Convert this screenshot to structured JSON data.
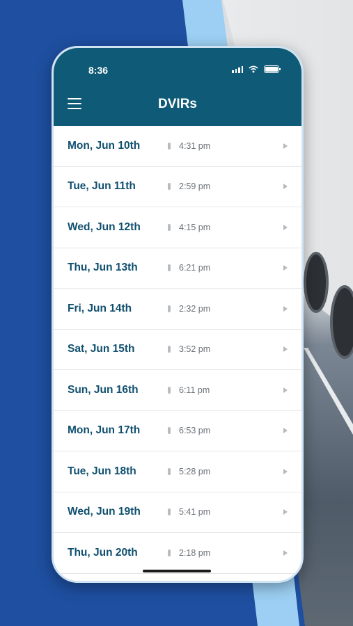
{
  "status": {
    "time": "8:36"
  },
  "header": {
    "title": "DVIRs"
  },
  "rows": [
    {
      "date": "Mon, Jun 10th",
      "time": "4:31 pm"
    },
    {
      "date": "Tue, Jun 11th",
      "time": "2:59 pm"
    },
    {
      "date": "Wed, Jun 12th",
      "time": "4:15 pm"
    },
    {
      "date": "Thu, Jun 13th",
      "time": "6:21 pm"
    },
    {
      "date": "Fri, Jun 14th",
      "time": "2:32 pm"
    },
    {
      "date": "Sat, Jun 15th",
      "time": "3:52 pm"
    },
    {
      "date": "Sun, Jun 16th",
      "time": "6:11 pm"
    },
    {
      "date": "Mon, Jun 17th",
      "time": "6:53 pm"
    },
    {
      "date": "Tue, Jun 18th",
      "time": "5:28 pm"
    },
    {
      "date": "Wed, Jun 19th",
      "time": "5:41 pm"
    },
    {
      "date": "Thu, Jun 20th",
      "time": "2:18 pm"
    }
  ],
  "icons": {
    "menu": "menu-icon",
    "signal": "signal-icon",
    "wifi": "wifi-icon",
    "battery": "battery-icon",
    "clip": "clip-icon",
    "chevron": "chevron-right-icon"
  },
  "colors": {
    "header": "#0f5a76",
    "date_text": "#0f4f6e",
    "background_blue": "#1e4fa0",
    "accent_light_blue": "#9ccff3"
  }
}
